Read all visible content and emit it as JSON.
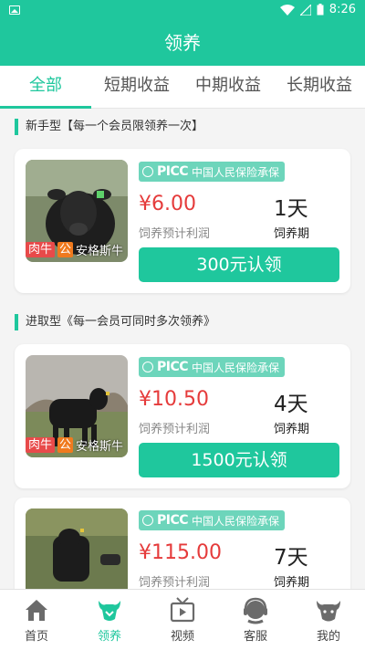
{
  "status": {
    "time": "8:26"
  },
  "header": {
    "title": "领养"
  },
  "tabs": [
    {
      "label": "全部"
    },
    {
      "label": "短期收益"
    },
    {
      "label": "中期收益"
    },
    {
      "label": "长期收益"
    }
  ],
  "sections": [
    {
      "title": "新手型【每一个会员限领养一次】"
    },
    {
      "title": "进取型《每一会员可同时多次领养》"
    }
  ],
  "insurance": {
    "brand": "PICC",
    "text": "中国人民保险承保"
  },
  "cards": [
    {
      "tag1": "肉牛",
      "tag2": "公",
      "breed": "安格斯牛",
      "price": "¥6.00",
      "price_label": "饲养预计利润",
      "days": "1天",
      "days_label": "饲养期",
      "button": "300元认领"
    },
    {
      "tag1": "肉牛",
      "tag2": "公",
      "breed": "安格斯牛",
      "price": "¥10.50",
      "price_label": "饲养预计利润",
      "days": "4天",
      "days_label": "饲养期",
      "button": "1500元认领"
    },
    {
      "price": "¥115.00",
      "price_label": "饲养预计利润",
      "days": "7天",
      "days_label": "饲养期"
    }
  ],
  "bottom_nav": [
    {
      "label": "首页",
      "icon": "home-icon"
    },
    {
      "label": "领养",
      "icon": "adopt-cow-icon"
    },
    {
      "label": "视频",
      "icon": "video-icon"
    },
    {
      "label": "客服",
      "icon": "customer-service-icon"
    },
    {
      "label": "我的",
      "icon": "profile-cow-icon"
    }
  ],
  "colors": {
    "primary": "#1fc79d",
    "price": "#e53b3b",
    "insurance_badge": "#6dd5bb"
  }
}
